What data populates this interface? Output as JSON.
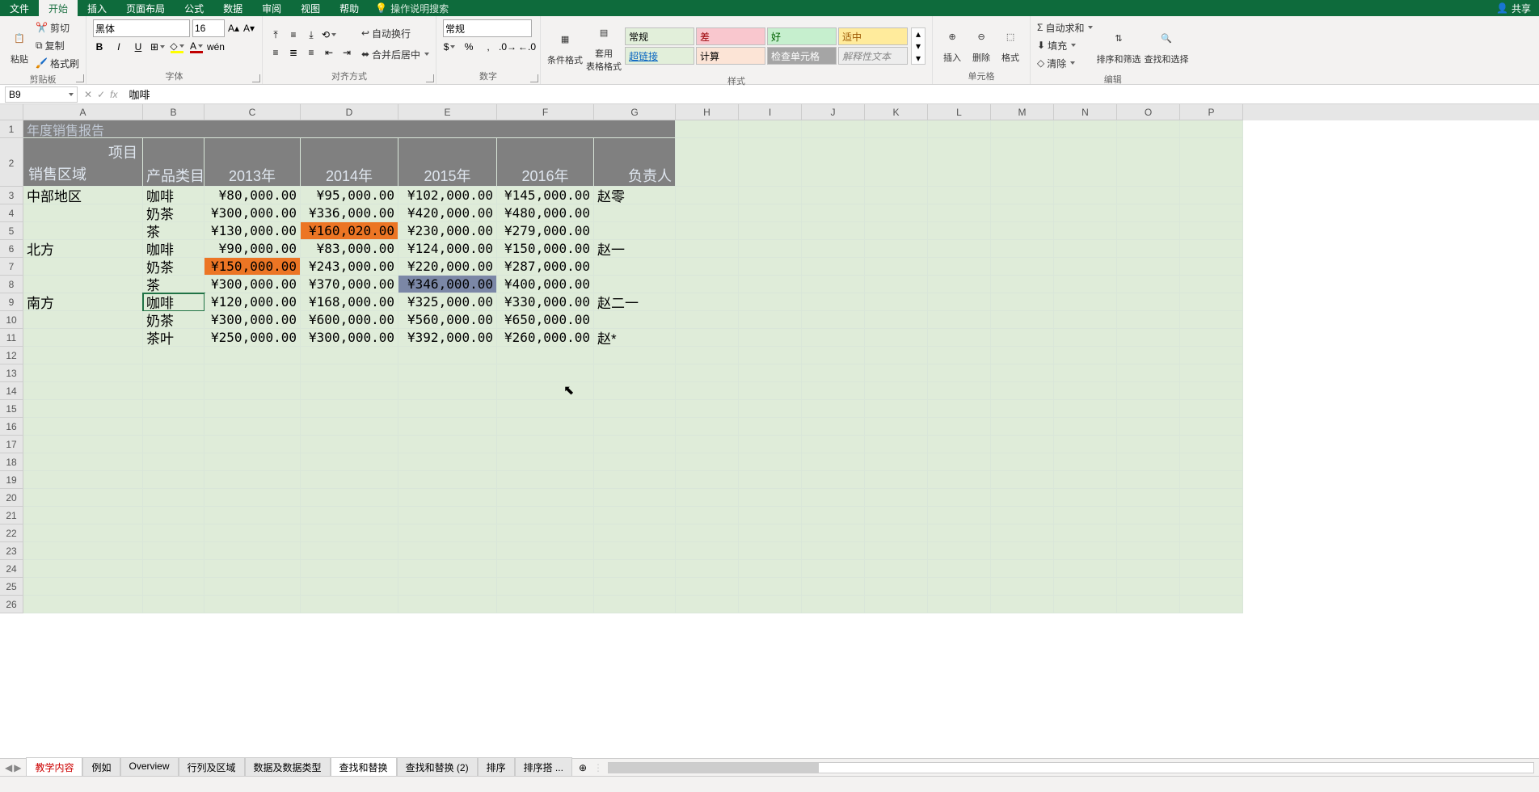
{
  "tabs": {
    "file": "文件",
    "home": "开始",
    "insert": "插入",
    "layout": "页面布局",
    "formula": "公式",
    "data": "数据",
    "review": "审阅",
    "view": "视图",
    "help": "帮助",
    "tellme": "操作说明搜索"
  },
  "share": "共享",
  "ribbon": {
    "clipboard": {
      "label": "剪贴板",
      "paste": "粘贴",
      "cut": "剪切",
      "copy": "复制",
      "painter": "格式刷"
    },
    "font": {
      "label": "字体",
      "name": "黑体",
      "size": "16"
    },
    "align": {
      "label": "对齐方式",
      "wrap": "自动换行",
      "merge": "合并后居中"
    },
    "number": {
      "label": "数字",
      "general": "常规"
    },
    "styles": {
      "label": "样式",
      "cond": "条件格式",
      "table": "套用\n表格格式",
      "cells": [
        "常规",
        "差",
        "好",
        "适中",
        "超链接",
        "计算",
        "检查单元格",
        "解释性文本"
      ]
    },
    "cells_grp": {
      "label": "单元格",
      "insert": "插入",
      "delete": "删除",
      "format": "格式"
    },
    "edit": {
      "label": "编辑",
      "sum": "自动求和",
      "fill": "填充",
      "clear": "清除",
      "sort": "排序和筛选",
      "find": "查找和选择"
    }
  },
  "namebox": "B9",
  "formula": "咖啡",
  "colHeads": [
    "A",
    "B",
    "C",
    "D",
    "E",
    "F",
    "G",
    "H",
    "I",
    "J",
    "K",
    "L",
    "M",
    "N",
    "O",
    "P"
  ],
  "rowCount": 26,
  "title": "年度销售报告",
  "header": {
    "proj": "项目",
    "region": "销售区域",
    "cat": "产品类目",
    "y1": "2013年",
    "y2": "2014年",
    "y3": "2015年",
    "y4": "2016年",
    "owner": "负责人"
  },
  "rows": [
    {
      "region": "中部地区",
      "cat": "咖啡",
      "c": "¥80,000.00",
      "d": "¥95,000.00",
      "e": "¥102,000.00",
      "f": "¥145,000.00",
      "g": "赵零"
    },
    {
      "region": "",
      "cat": "奶茶",
      "c": "¥300,000.00",
      "d": "¥336,000.00",
      "e": "¥420,000.00",
      "f": "¥480,000.00",
      "g": ""
    },
    {
      "region": "",
      "cat": "茶",
      "c": "¥130,000.00",
      "d": "¥160,020.00",
      "e": "¥230,000.00",
      "f": "¥279,000.00",
      "g": "",
      "hl": {
        "d": "orange"
      }
    },
    {
      "region": "北方",
      "cat": "咖啡",
      "c": "¥90,000.00",
      "d": "¥83,000.00",
      "e": "¥124,000.00",
      "f": "¥150,000.00",
      "g": "赵一"
    },
    {
      "region": "",
      "cat": "奶茶",
      "c": "¥150,000.00",
      "d": "¥243,000.00",
      "e": "¥220,000.00",
      "f": "¥287,000.00",
      "g": "",
      "hl": {
        "c": "orange"
      }
    },
    {
      "region": "",
      "cat": "茶",
      "c": "¥300,000.00",
      "d": "¥370,000.00",
      "e": "¥346,000.00",
      "f": "¥400,000.00",
      "g": "",
      "hl": {
        "e": "slate"
      }
    },
    {
      "region": "南方",
      "cat": "咖啡",
      "c": "¥120,000.00",
      "d": "¥168,000.00",
      "e": "¥325,000.00",
      "f": "¥330,000.00",
      "g": "赵二一"
    },
    {
      "region": "",
      "cat": "奶茶",
      "c": "¥300,000.00",
      "d": "¥600,000.00",
      "e": "¥560,000.00",
      "f": "¥650,000.00",
      "g": ""
    },
    {
      "region": "",
      "cat": "茶叶",
      "c": "¥250,000.00",
      "d": "¥300,000.00",
      "e": "¥392,000.00",
      "f": "¥260,000.00",
      "g": "赵*"
    }
  ],
  "sheets": [
    "教学内容",
    "例如",
    "Overview",
    "行列及区域",
    "数据及数据类型",
    "查找和替换",
    "查找和替换 (2)",
    "排序",
    "排序搭 ..."
  ],
  "activeSheet": 5,
  "styleColors": {
    "常规": "#e2efda",
    "差": "#f9c7ce",
    "好": "#c6efce",
    "适中": "#ffeb9c",
    "超链接": "#e2efda",
    "计算": "#fce4d6",
    "检查单元格": "#a5a5a5",
    "解释性文本": "#ededed"
  }
}
